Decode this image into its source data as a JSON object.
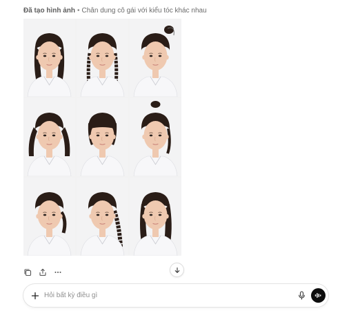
{
  "header": {
    "title": "Đã tạo hình ảnh",
    "separator": "•",
    "caption": "Chân dung cô gái với kiểu tóc khác nhau"
  },
  "image_grid": {
    "columns": 3,
    "rows": 3,
    "cells": [
      {
        "hairstyle": "straight-shoulder"
      },
      {
        "hairstyle": "low-braids"
      },
      {
        "hairstyle": "side-swept-bun"
      },
      {
        "hairstyle": "pigtails"
      },
      {
        "hairstyle": "bangs-bob"
      },
      {
        "hairstyle": "top-bun"
      },
      {
        "hairstyle": "low-ponytail"
      },
      {
        "hairstyle": "side-braid"
      },
      {
        "hairstyle": "long-straight"
      }
    ]
  },
  "actions": {
    "icons": [
      "copy-icon",
      "share-icon",
      "more-icon"
    ]
  },
  "scroll": {
    "icon": "arrow-down-icon"
  },
  "composer": {
    "placeholder": "Hỏi bất kỳ điều gì",
    "value": "",
    "plus_icon": "plus-icon",
    "mic_icon": "mic-icon",
    "voice_icon": "voice-mode-icon"
  },
  "colors": {
    "accent_dark": "#0d0d0d",
    "text_muted": "#6b6b6b",
    "border": "#e3e3e3",
    "skin": "#efc9b0",
    "hair": "#2a1d17",
    "shirt": "#f7f7f9"
  }
}
